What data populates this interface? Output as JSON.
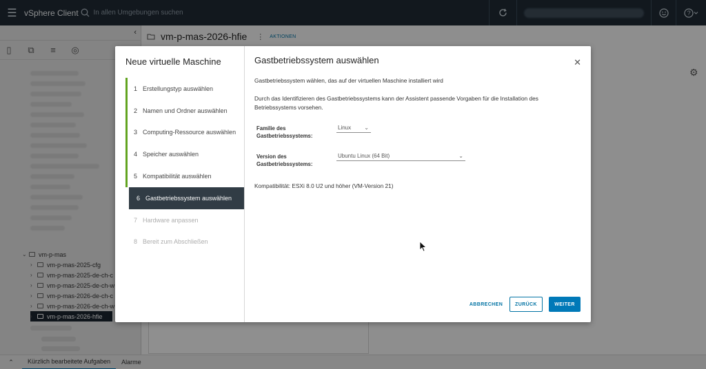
{
  "header": {
    "app_title": "vSphere Client",
    "search_placeholder": "In allen Umgebungen suchen"
  },
  "breadcrumb": {
    "title": "vm-p-mas-2026-hfie",
    "actions_label": "AKTIONEN"
  },
  "tree": {
    "items": [
      {
        "label": "vm-p-mas",
        "level": 1,
        "expanded": true
      },
      {
        "label": "vm-p-mas-2025-cfg",
        "level": 2
      },
      {
        "label": "vm-p-mas-2025-de-ch-c",
        "level": 2
      },
      {
        "label": "vm-p-mas-2025-de-ch-w",
        "level": 2
      },
      {
        "label": "vm-p-mas-2026-de-ch-c",
        "level": 2
      },
      {
        "label": "vm-p-mas-2026-de-ch-w",
        "level": 2
      },
      {
        "label": "vm-p-mas-2026-hfie",
        "level": 2,
        "selected": true
      }
    ]
  },
  "bottombar": {
    "tabs": [
      "Kürzlich bearbeitete Aufgaben",
      "Alarme"
    ]
  },
  "wizard": {
    "title": "Neue virtuelle Maschine",
    "steps": [
      {
        "num": "1",
        "label": "Erstellungstyp auswählen",
        "state": "done"
      },
      {
        "num": "2",
        "label": "Namen und Ordner auswählen",
        "state": "done"
      },
      {
        "num": "3",
        "label": "Computing-Ressource auswählen",
        "state": "done"
      },
      {
        "num": "4",
        "label": "Speicher auswählen",
        "state": "done"
      },
      {
        "num": "5",
        "label": "Kompatibilität auswählen",
        "state": "done"
      },
      {
        "num": "6",
        "label": "Gastbetriebssystem auswählen",
        "state": "active"
      },
      {
        "num": "7",
        "label": "Hardware anpassen",
        "state": "disabled"
      },
      {
        "num": "8",
        "label": "Bereit zum Abschließen",
        "state": "disabled"
      }
    ],
    "page": {
      "heading": "Gastbetriebssystem auswählen",
      "description": "Gastbetriebssystem wählen, das auf der virtuellen Maschine installiert wird",
      "info": "Durch das Identifizieren des Gastbetriebssystems kann der Assistent passende Vorgaben für die Installation des Betriebssystems vorsehen.",
      "family_label": "Familie des Gastbetriebssystems:",
      "family_value": "Linux",
      "version_label": "Version des Gastbetriebssystems:",
      "version_value": "Ubuntu Linux (64 Bit)",
      "compatibility": "Kompatibilität: ESXi 8.0 U2 und höher (VM-Version 21)"
    },
    "buttons": {
      "cancel": "ABBRECHEN",
      "back": "ZURÜCK",
      "next": "WEITER"
    }
  },
  "colors": {
    "header_bg": "#1f2a35",
    "primary": "#0079b8",
    "done_bar": "#62a420",
    "active_step_bg": "#313c45"
  }
}
